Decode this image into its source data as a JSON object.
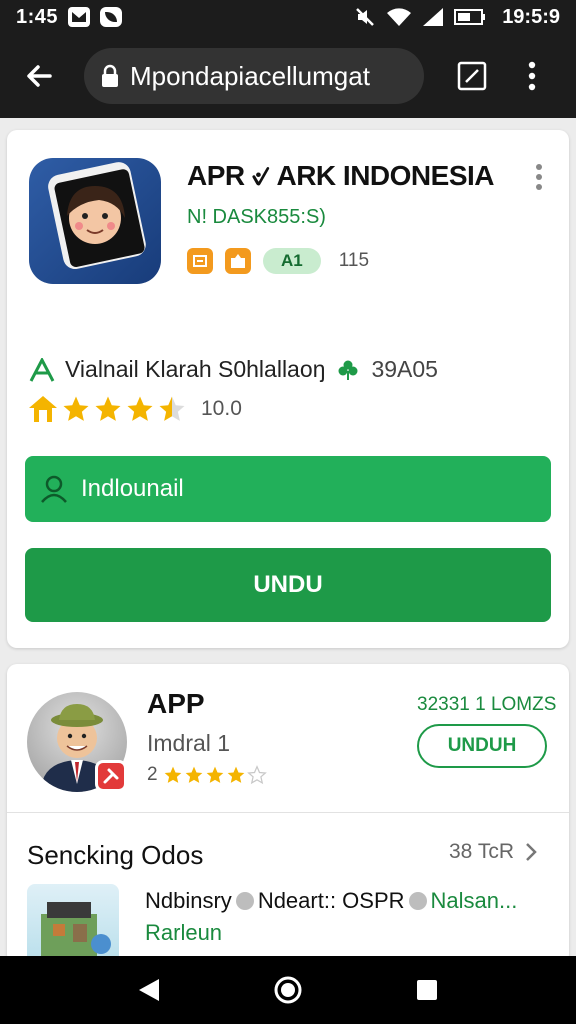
{
  "status_bar": {
    "left_time": "1:45",
    "clock": "19:5:9"
  },
  "toolbar": {
    "url": "Mpondapiacellumgat"
  },
  "app_card": {
    "title": "APR ୰ ARK INDONESIA",
    "developer": "N! DASK855:S)",
    "badge_label": "A1",
    "badge_count": "115",
    "info_label": "Vialnail Klarah S0hlallaoŋ",
    "info_size": "39A05",
    "rating_value": "10.0",
    "rating_stars": 3.5,
    "install_label": "Indlounail",
    "download_label": "UNDU"
  },
  "app2": {
    "title": "APP",
    "subtitle": "Imdral 1",
    "rating_num": "2",
    "rating_stars": 4,
    "count": "32331 1 LOMZS",
    "button_label": "UNDUH"
  },
  "section": {
    "title": "Sencking Odos",
    "link_text": "38 TcR"
  },
  "list_item": {
    "part1": "Ndbinsry",
    "part2": "Ndeart:: OSPR",
    "part3": "Nalsan...",
    "line2": "Rarleun"
  },
  "colors": {
    "accent_green": "#1e9a48",
    "install_green": "#22b05a",
    "star_gold": "#f4b400",
    "dark_bar": "#1c1c1c"
  }
}
